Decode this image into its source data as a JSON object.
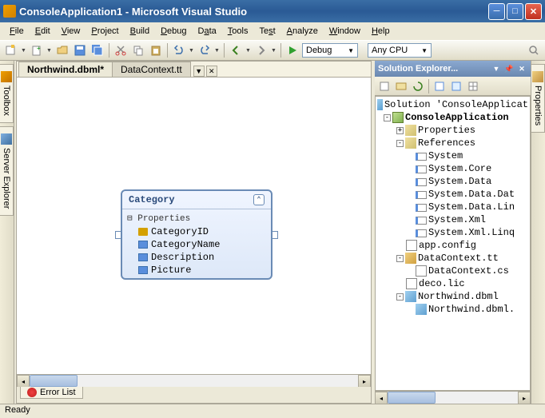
{
  "window": {
    "title": "ConsoleApplication1 - Microsoft Visual Studio"
  },
  "menu": {
    "file": "File",
    "edit": "Edit",
    "view": "View",
    "project": "Project",
    "build": "Build",
    "debug": "Debug",
    "data": "Data",
    "tools": "Tools",
    "test": "Test",
    "analyze": "Analyze",
    "window": "Window",
    "help": "Help"
  },
  "toolbar": {
    "config": "Debug",
    "platform": "Any CPU"
  },
  "leftRail": {
    "toolbox": "Toolbox",
    "serverExplorer": "Server Explorer"
  },
  "rightRail": {
    "properties": "Properties"
  },
  "tabs": {
    "active": "Northwind.dbml*",
    "inactive": "DataContext.tt"
  },
  "designer": {
    "entity": "Category",
    "section": "Properties",
    "props": [
      "CategoryID",
      "CategoryName",
      "Description",
      "Picture"
    ]
  },
  "bottom": {
    "errorList": "Error List"
  },
  "solutionExplorer": {
    "title": "Solution Explorer...",
    "solution": "Solution 'ConsoleApplicat",
    "project": "ConsoleApplication",
    "properties": "Properties",
    "references": "References",
    "refs": [
      "System",
      "System.Core",
      "System.Data",
      "System.Data.Dat",
      "System.Data.Lin",
      "System.Xml",
      "System.Xml.Linq"
    ],
    "files": {
      "appConfig": "app.config",
      "dataContextTt": "DataContext.tt",
      "dataContextCs": "DataContext.cs",
      "decoLic": "deco.lic",
      "northwindDbml": "Northwind.dbml",
      "northwindDbmlSub": "Northwind.dbml."
    }
  },
  "status": "Ready"
}
